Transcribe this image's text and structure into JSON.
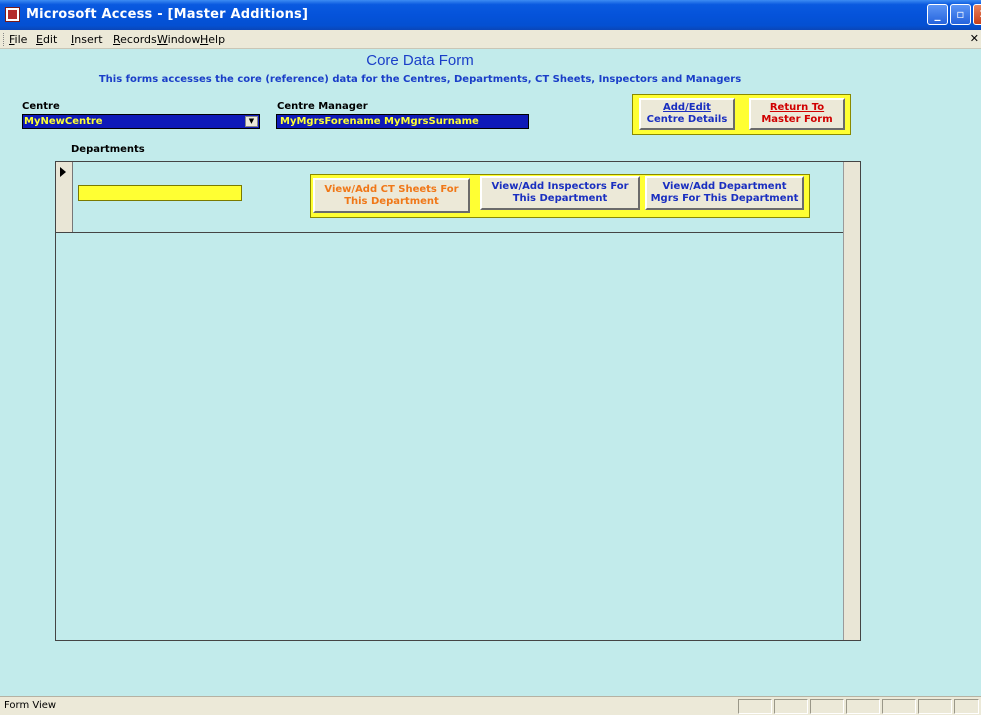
{
  "window": {
    "title": "Microsoft Access - [Master Additions]",
    "controls": [
      "minimize",
      "restore",
      "close"
    ]
  },
  "menu": {
    "items": [
      {
        "key": "F",
        "rest": "ile"
      },
      {
        "key": "E",
        "rest": "dit"
      },
      {
        "key": "I",
        "rest": "nsert"
      },
      {
        "key": "R",
        "rest": "ecords"
      },
      {
        "key": "W",
        "rest": "indow"
      },
      {
        "key": "H",
        "rest": "elp"
      }
    ]
  },
  "form": {
    "title": "Core Data Form",
    "subtitle": "This forms accesses the core (reference) data for the Centres, Departments, CT Sheets, Inspectors and Managers",
    "centre_label": "Centre",
    "centre_value": "MyNewCentre",
    "manager_label": "Centre Manager",
    "manager_value": "MyMgrsForename MyMgrsSurname",
    "departments_label": "Departments"
  },
  "buttons": {
    "edit_centre": {
      "line1": "Add/Edit",
      "line2": "Centre Details"
    },
    "return_master": {
      "line1": "Return To",
      "line2": "Master Form"
    },
    "view_ct": {
      "line1": "View/Add CT Sheets For",
      "line2": "This Department"
    },
    "view_inspectors": {
      "line1": "View/Add Inspectors For",
      "line2": "This Department"
    },
    "view_mgrs": {
      "line1": "View/Add Department",
      "line2": "Mgrs For This Department"
    }
  },
  "department": {
    "value": ""
  },
  "status": {
    "text": "Form View"
  },
  "colors": {
    "background": "#c2ebeb",
    "field_blue": "#0f1ab8",
    "field_text": "#ffff33",
    "panel_yellow": "#ffff33",
    "label_blue": "#1a3ec8"
  }
}
